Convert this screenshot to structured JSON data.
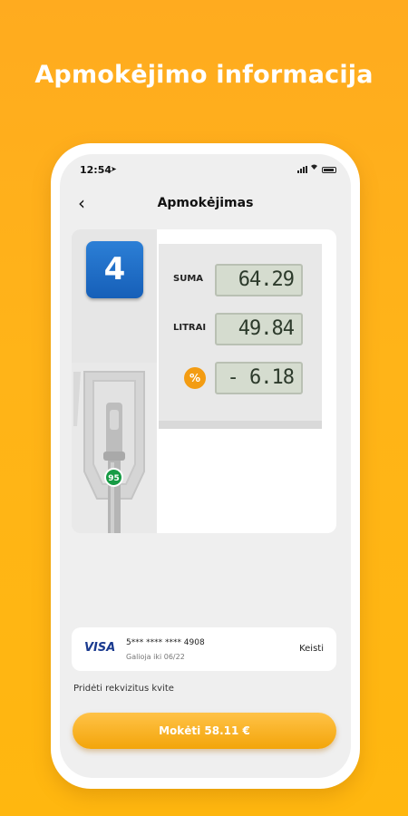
{
  "headline": "Apmokėjimo informacija",
  "status_bar": {
    "time": "12:54",
    "location_glyph": "➤"
  },
  "nav": {
    "back_glyph": "‹",
    "title": "Apmokėjimas"
  },
  "pump": {
    "number": "4",
    "fuel_grade": "95",
    "rows": {
      "sum": {
        "label": "SUMA",
        "value": "64.29"
      },
      "liters": {
        "label": "LITRAI",
        "value": "49.84"
      },
      "discount": {
        "icon": "%",
        "value": "- 6.18"
      }
    }
  },
  "payment_card": {
    "brand": "VISA",
    "masked_number": "5*** **** **** 4908",
    "expiry": "Galioja iki 06/22",
    "change_label": "Keisti"
  },
  "invoice_link": "Pridėti rekvizitus kvite",
  "pay_button": "Mokėti 58.11 €",
  "colors": {
    "accent": "#ffb418",
    "pump_number_bg": "#1f6fcc",
    "fuel_badge": "#179b45",
    "lcd_bg": "#d5dccf"
  }
}
